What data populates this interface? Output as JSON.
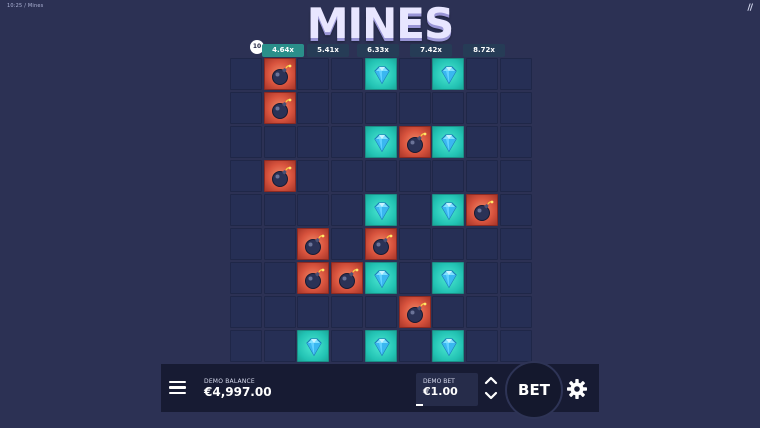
{
  "header": {
    "time_label": "10:25 / Mines",
    "title": "MINES",
    "corner_logo": "//"
  },
  "multipliers": {
    "mine_count": "10",
    "values": [
      "4.64x",
      "5.41x",
      "6.33x",
      "7.42x",
      "8.72x"
    ],
    "active_index": 0
  },
  "board": {
    "rows": 9,
    "cols": 9,
    "cells": [
      [
        "empty",
        "bomb",
        "empty",
        "empty",
        "gem",
        "empty",
        "gem",
        "empty",
        "empty"
      ],
      [
        "empty",
        "bomb",
        "empty",
        "empty",
        "empty",
        "empty",
        "empty",
        "empty",
        "empty"
      ],
      [
        "empty",
        "empty",
        "empty",
        "empty",
        "gem",
        "bomb",
        "gem",
        "empty",
        "empty"
      ],
      [
        "empty",
        "bomb",
        "empty",
        "empty",
        "empty",
        "empty",
        "empty",
        "empty",
        "empty"
      ],
      [
        "empty",
        "empty",
        "empty",
        "empty",
        "gem",
        "empty",
        "gem",
        "bomb",
        "empty"
      ],
      [
        "empty",
        "empty",
        "bomb",
        "empty",
        "bomb",
        "empty",
        "empty",
        "empty",
        "empty"
      ],
      [
        "empty",
        "empty",
        "bomb",
        "bomb",
        "gem",
        "empty",
        "gem",
        "empty",
        "empty"
      ],
      [
        "empty",
        "empty",
        "empty",
        "empty",
        "empty",
        "bomb",
        "empty",
        "empty",
        "empty"
      ],
      [
        "empty",
        "empty",
        "gem",
        "empty",
        "gem",
        "empty",
        "gem",
        "empty",
        "empty"
      ]
    ],
    "icons": {
      "gem": "diamond-icon",
      "bomb": "bomb-icon"
    }
  },
  "controls": {
    "menu_icon": "hamburger-menu-icon",
    "balance_label": "DEMO BALANCE",
    "balance_value": "€4,997.00",
    "bet_label": "DEMO BET",
    "bet_value": "€1.00",
    "bet_button": "BET",
    "settings_icon": "gear-icon",
    "up_icon": "chevron-up-icon",
    "down_icon": "chevron-down-icon"
  },
  "colors": {
    "background": "#2c3154",
    "gem": "#22c2b3",
    "bomb": "#d9543e",
    "active_multiplier": "#2a8f8a"
  }
}
